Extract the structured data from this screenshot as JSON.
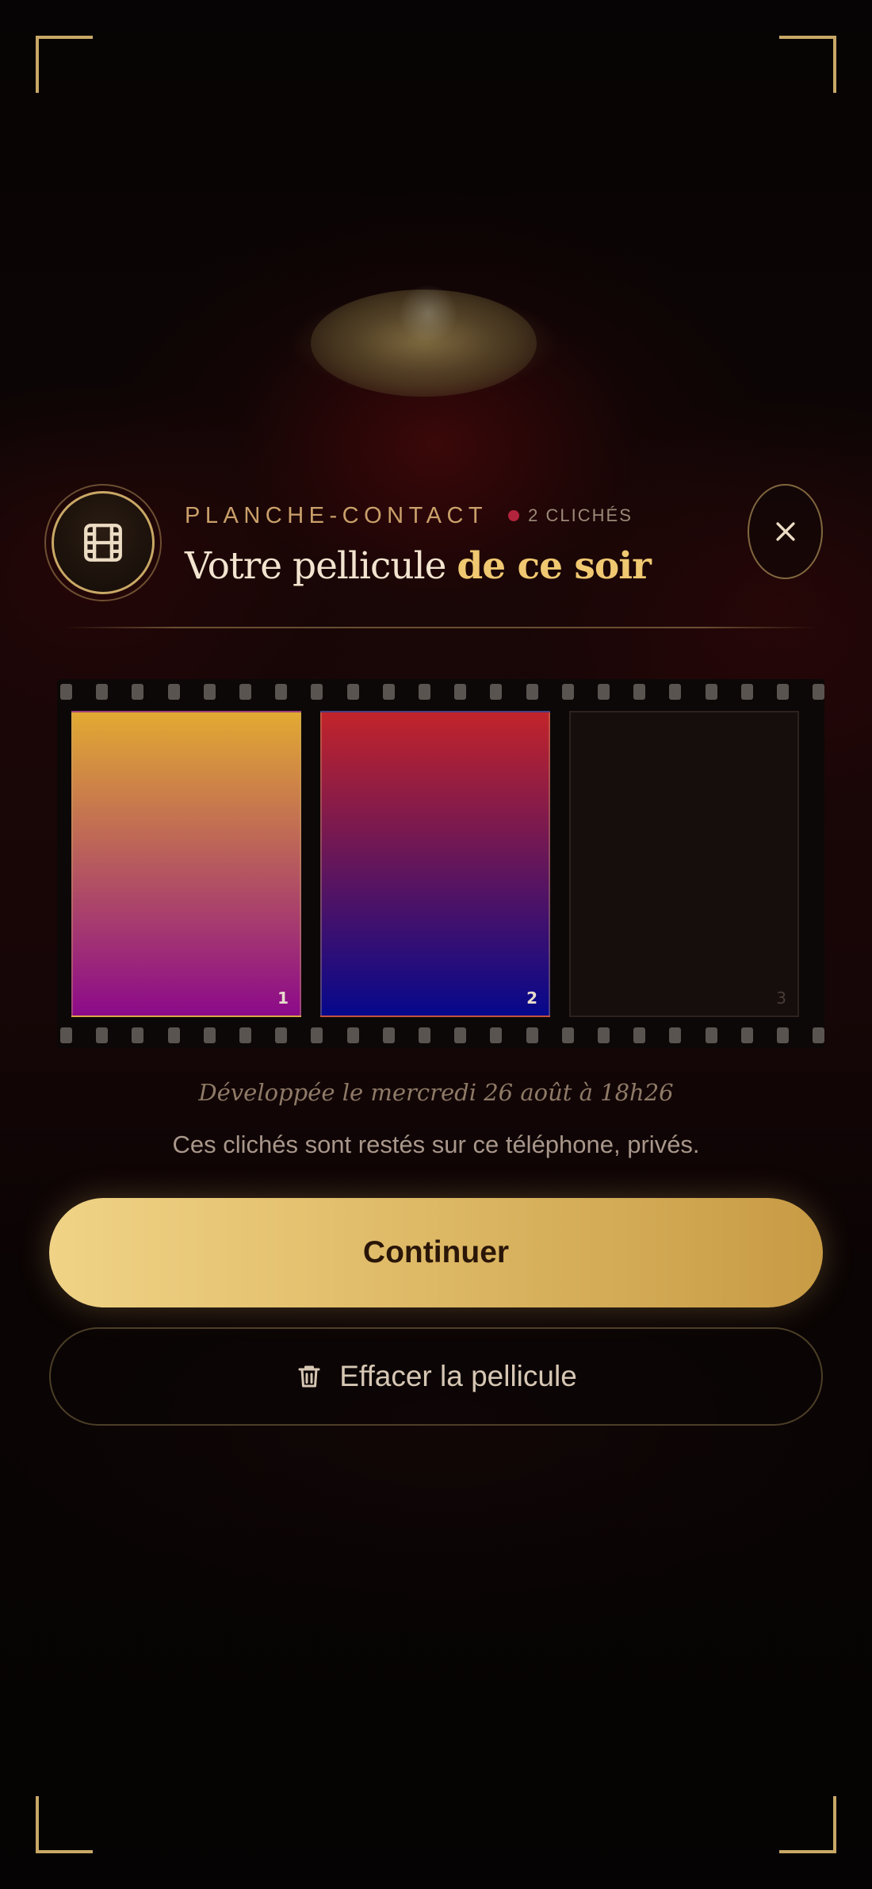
{
  "header": {
    "eyebrow": "PLANCHE-CONTACT",
    "count": "2 CLICHÉS",
    "title_plain": "Votre pellicule",
    "title_emphasis": "de ce soir",
    "icons": {
      "badge": "film-icon",
      "close": "close-icon"
    }
  },
  "film_strip": {
    "frames": [
      {
        "number": "1",
        "state": "filled",
        "gradient": [
          "#e2aa32",
          "#8c0a8a"
        ]
      },
      {
        "number": "2",
        "state": "filled",
        "gradient": [
          "#c2242a",
          "#06088c"
        ]
      },
      {
        "number": "3",
        "state": "empty",
        "gradient": [
          "#150e0d",
          "#150e0d"
        ]
      }
    ]
  },
  "developed_text": "Développée le mercredi 26 août à 18h26",
  "privacy_text": "Ces clichés sont restés sur ce téléphone, privés.",
  "actions": {
    "continue_label": "Continuer",
    "erase_label": "Effacer la pellicule",
    "erase_icon": "trash-icon"
  },
  "colors": {
    "accent_gold": "#f0c871",
    "frame_gold": "#c9a866",
    "count_dot": "#b2243c"
  }
}
